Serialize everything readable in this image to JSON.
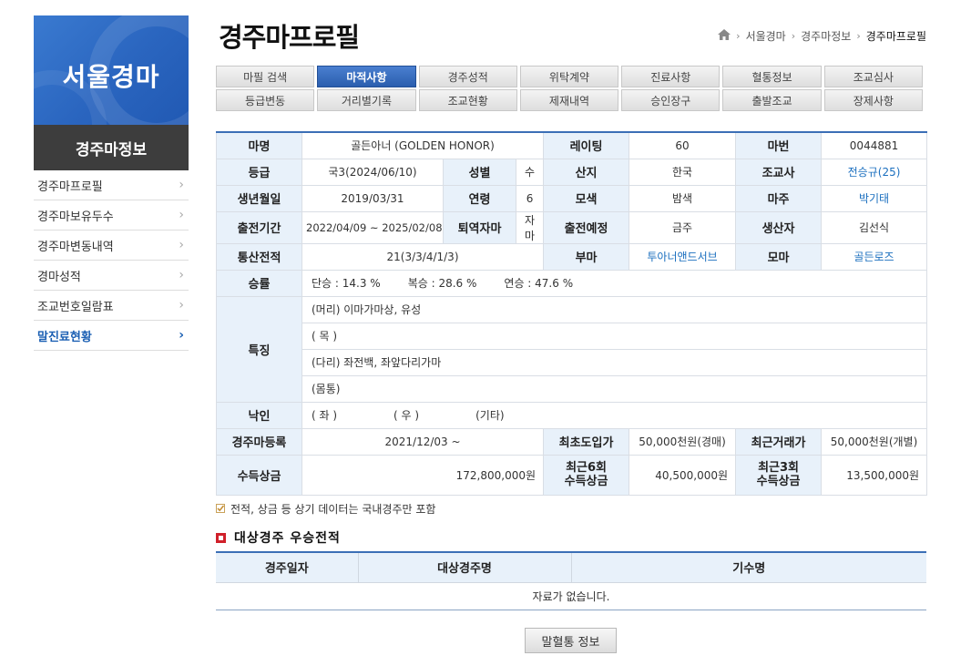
{
  "sidebar": {
    "brand": "서울경마",
    "section_title": "경주마정보",
    "items": [
      {
        "label": "경주마프로필"
      },
      {
        "label": "경주마보유두수"
      },
      {
        "label": "경주마변동내역"
      },
      {
        "label": "경마성적"
      },
      {
        "label": "조교번호일람표"
      },
      {
        "label": "말진료현황"
      }
    ],
    "active_index": 5
  },
  "header": {
    "title": "경주마프로필",
    "breadcrumb": [
      "서울경마",
      "경주마정보",
      "경주마프로필"
    ]
  },
  "tabs": [
    {
      "label": "마필 검색"
    },
    {
      "label": "마적사항",
      "active": true
    },
    {
      "label": "경주성적"
    },
    {
      "label": "위탁계약"
    },
    {
      "label": "진료사항"
    },
    {
      "label": "혈통정보"
    },
    {
      "label": "조교심사"
    },
    {
      "label": "등급변동"
    },
    {
      "label": "거리별기록"
    },
    {
      "label": "조교현황"
    },
    {
      "label": "제재내역"
    },
    {
      "label": "승인장구"
    },
    {
      "label": "출발조교"
    },
    {
      "label": "장제사항"
    }
  ],
  "profile": {
    "name_label": "마명",
    "name": "골든아너 (GOLDEN HONOR)",
    "rating_label": "레이팅",
    "rating": "60",
    "horse_no_label": "마번",
    "horse_no": "0044881",
    "grade_label": "등급",
    "grade": "국3(2024/06/10)",
    "sex_label": "성별",
    "sex": "수",
    "origin_label": "산지",
    "origin": "한국",
    "trainer_label": "조교사",
    "trainer": "전승규(25)",
    "birth_label": "생년월일",
    "birth": "2019/03/31",
    "age_label": "연령",
    "age": "6",
    "color_label": "모색",
    "color": "밤색",
    "owner_label": "마주",
    "owner": "박기태",
    "race_period_label": "출전기간",
    "race_period": "2022/04/09 ~ 2025/02/08",
    "retire_label": "퇴역자마",
    "retire": "자마",
    "planned_label": "출전예정",
    "planned": "금주",
    "breeder_label": "생산자",
    "breeder": "김선식",
    "record_label": "통산전적",
    "record": "21(3/3/4/1/3)",
    "sire_label": "부마",
    "sire": "투아너앤드서브",
    "dam_label": "모마",
    "dam": "골든로즈",
    "win_rate_label": "승률",
    "win_rate_single": "단승 : 14.3 %",
    "win_rate_place": "복승 : 28.6 %",
    "win_rate_show": "연승 : 47.6 %",
    "features_label": "특징",
    "feature_head": "(머리) 이마가마상, 유성",
    "feature_neck": "( 목 )",
    "feature_legs": "(다리) 좌전백, 좌앞다리가마",
    "feature_body": "(몸통)",
    "brand_label": "낙인",
    "brand_left": "( 좌 )",
    "brand_right": "( 우 )",
    "brand_other": "(기타)",
    "reg_label": "경주마등록",
    "reg": "2021/12/03 ~",
    "first_price_label": "최초도입가",
    "first_price": "50,000천원(경매)",
    "recent_price_label": "최근거래가",
    "recent_price": "50,000천원(개별)",
    "prize_label": "수득상금",
    "prize": "172,800,000원",
    "prize6_label_1": "최근6회",
    "prize6_label_2": "수득상금",
    "prize6": "40,500,000원",
    "prize3_label_1": "최근3회",
    "prize3_label_2": "수득상금",
    "prize3": "13,500,000원"
  },
  "note": "전적, 상금 등 상기 데이터는 국내경주만 포함",
  "wins": {
    "title": "대상경주 우승전적",
    "columns": [
      "경주일자",
      "대상경주명",
      "기수명"
    ],
    "empty": "자료가 없습니다."
  },
  "pedigree_button": "말혈통 정보"
}
